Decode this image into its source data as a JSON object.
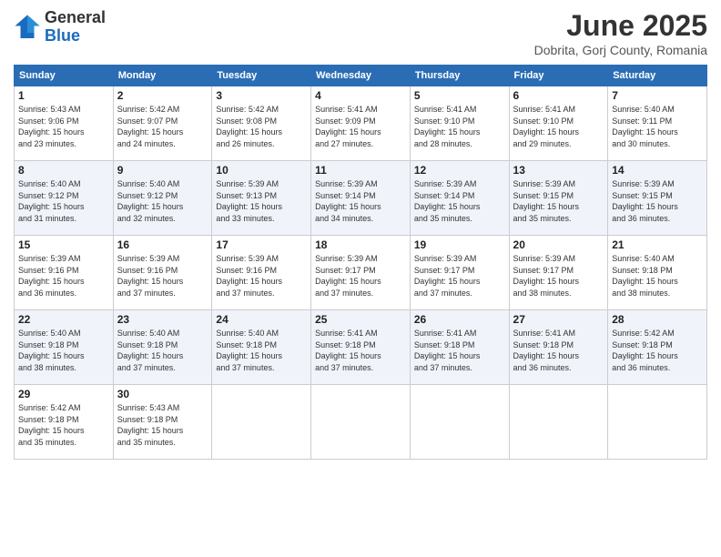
{
  "header": {
    "logo_general": "General",
    "logo_blue": "Blue",
    "month_title": "June 2025",
    "location": "Dobrita, Gorj County, Romania"
  },
  "calendar": {
    "days_of_week": [
      "Sunday",
      "Monday",
      "Tuesday",
      "Wednesday",
      "Thursday",
      "Friday",
      "Saturday"
    ],
    "weeks": [
      [
        {
          "day": "1",
          "info": "Sunrise: 5:43 AM\nSunset: 9:06 PM\nDaylight: 15 hours\nand 23 minutes."
        },
        {
          "day": "2",
          "info": "Sunrise: 5:42 AM\nSunset: 9:07 PM\nDaylight: 15 hours\nand 24 minutes."
        },
        {
          "day": "3",
          "info": "Sunrise: 5:42 AM\nSunset: 9:08 PM\nDaylight: 15 hours\nand 26 minutes."
        },
        {
          "day": "4",
          "info": "Sunrise: 5:41 AM\nSunset: 9:09 PM\nDaylight: 15 hours\nand 27 minutes."
        },
        {
          "day": "5",
          "info": "Sunrise: 5:41 AM\nSunset: 9:10 PM\nDaylight: 15 hours\nand 28 minutes."
        },
        {
          "day": "6",
          "info": "Sunrise: 5:41 AM\nSunset: 9:10 PM\nDaylight: 15 hours\nand 29 minutes."
        },
        {
          "day": "7",
          "info": "Sunrise: 5:40 AM\nSunset: 9:11 PM\nDaylight: 15 hours\nand 30 minutes."
        }
      ],
      [
        {
          "day": "8",
          "info": "Sunrise: 5:40 AM\nSunset: 9:12 PM\nDaylight: 15 hours\nand 31 minutes."
        },
        {
          "day": "9",
          "info": "Sunrise: 5:40 AM\nSunset: 9:12 PM\nDaylight: 15 hours\nand 32 minutes."
        },
        {
          "day": "10",
          "info": "Sunrise: 5:39 AM\nSunset: 9:13 PM\nDaylight: 15 hours\nand 33 minutes."
        },
        {
          "day": "11",
          "info": "Sunrise: 5:39 AM\nSunset: 9:14 PM\nDaylight: 15 hours\nand 34 minutes."
        },
        {
          "day": "12",
          "info": "Sunrise: 5:39 AM\nSunset: 9:14 PM\nDaylight: 15 hours\nand 35 minutes."
        },
        {
          "day": "13",
          "info": "Sunrise: 5:39 AM\nSunset: 9:15 PM\nDaylight: 15 hours\nand 35 minutes."
        },
        {
          "day": "14",
          "info": "Sunrise: 5:39 AM\nSunset: 9:15 PM\nDaylight: 15 hours\nand 36 minutes."
        }
      ],
      [
        {
          "day": "15",
          "info": "Sunrise: 5:39 AM\nSunset: 9:16 PM\nDaylight: 15 hours\nand 36 minutes."
        },
        {
          "day": "16",
          "info": "Sunrise: 5:39 AM\nSunset: 9:16 PM\nDaylight: 15 hours\nand 37 minutes."
        },
        {
          "day": "17",
          "info": "Sunrise: 5:39 AM\nSunset: 9:16 PM\nDaylight: 15 hours\nand 37 minutes."
        },
        {
          "day": "18",
          "info": "Sunrise: 5:39 AM\nSunset: 9:17 PM\nDaylight: 15 hours\nand 37 minutes."
        },
        {
          "day": "19",
          "info": "Sunrise: 5:39 AM\nSunset: 9:17 PM\nDaylight: 15 hours\nand 37 minutes."
        },
        {
          "day": "20",
          "info": "Sunrise: 5:39 AM\nSunset: 9:17 PM\nDaylight: 15 hours\nand 38 minutes."
        },
        {
          "day": "21",
          "info": "Sunrise: 5:40 AM\nSunset: 9:18 PM\nDaylight: 15 hours\nand 38 minutes."
        }
      ],
      [
        {
          "day": "22",
          "info": "Sunrise: 5:40 AM\nSunset: 9:18 PM\nDaylight: 15 hours\nand 38 minutes."
        },
        {
          "day": "23",
          "info": "Sunrise: 5:40 AM\nSunset: 9:18 PM\nDaylight: 15 hours\nand 37 minutes."
        },
        {
          "day": "24",
          "info": "Sunrise: 5:40 AM\nSunset: 9:18 PM\nDaylight: 15 hours\nand 37 minutes."
        },
        {
          "day": "25",
          "info": "Sunrise: 5:41 AM\nSunset: 9:18 PM\nDaylight: 15 hours\nand 37 minutes."
        },
        {
          "day": "26",
          "info": "Sunrise: 5:41 AM\nSunset: 9:18 PM\nDaylight: 15 hours\nand 37 minutes."
        },
        {
          "day": "27",
          "info": "Sunrise: 5:41 AM\nSunset: 9:18 PM\nDaylight: 15 hours\nand 36 minutes."
        },
        {
          "day": "28",
          "info": "Sunrise: 5:42 AM\nSunset: 9:18 PM\nDaylight: 15 hours\nand 36 minutes."
        }
      ],
      [
        {
          "day": "29",
          "info": "Sunrise: 5:42 AM\nSunset: 9:18 PM\nDaylight: 15 hours\nand 35 minutes."
        },
        {
          "day": "30",
          "info": "Sunrise: 5:43 AM\nSunset: 9:18 PM\nDaylight: 15 hours\nand 35 minutes."
        },
        {
          "day": "",
          "info": ""
        },
        {
          "day": "",
          "info": ""
        },
        {
          "day": "",
          "info": ""
        },
        {
          "day": "",
          "info": ""
        },
        {
          "day": "",
          "info": ""
        }
      ]
    ]
  }
}
